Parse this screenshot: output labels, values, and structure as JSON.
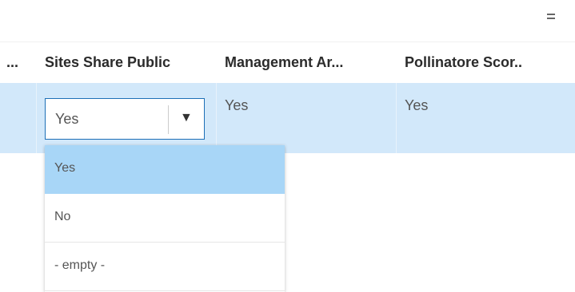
{
  "toolbar": {
    "menu_icon": "hamburger-menu-icon"
  },
  "table": {
    "columns": [
      "...",
      "Sites Share Public",
      "Management Ar...",
      "Pollinatore Scor.."
    ],
    "row": {
      "sites_share_public": "Yes",
      "management_area": "Yes",
      "pollinatore_score": "Yes"
    }
  },
  "editor": {
    "selected_value": "Yes",
    "arrow": "▼",
    "options": [
      "Yes",
      "No",
      "- empty -"
    ],
    "highlighted_index": 0
  },
  "colors": {
    "row_selected": "#d2e8fa",
    "option_highlight": "#a8d6f7",
    "select_border": "#1d6fb6"
  }
}
